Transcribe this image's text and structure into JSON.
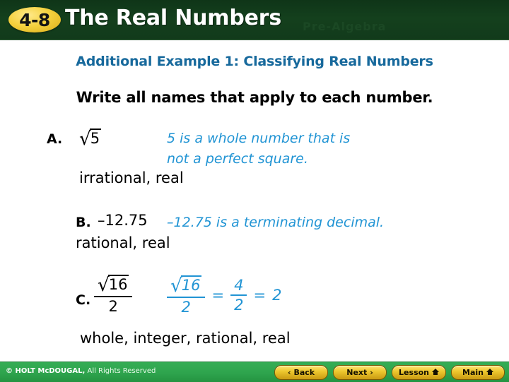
{
  "header": {
    "badge": "4-8",
    "title": "The Real Numbers",
    "watermark": "Pre-Algebra",
    "bg_color": "#123a1b",
    "badge_color": "#f5d23f"
  },
  "subtitle": "Additional Example 1: Classifying Real Numbers",
  "prompt": "Write all names that apply to each number.",
  "accent_blue": "#2194d4",
  "subtitle_color": "#17699c",
  "items": [
    {
      "letter": "A.",
      "radical_sign": "√",
      "radicand": "5",
      "note_line1": "5 is a whole number that is",
      "note_line2": "not a perfect square.",
      "answer": "irrational, real"
    },
    {
      "letter": "B.",
      "value": "–12.75",
      "note_line1": "–12.75 is a terminating decimal.",
      "answer": "rational, real"
    },
    {
      "letter": "C.",
      "radical_sign": "√",
      "radicand": "16",
      "denominator": "2",
      "eq_op1": "=",
      "eq_num": "4",
      "eq_den": "2",
      "eq_op2": "=",
      "eq_result": "2",
      "answer": "whole, integer, rational, real"
    }
  ],
  "footer": {
    "copyright_strong": "© HOLT McDOUGAL,",
    "copyright_rest": " All Rights Reserved",
    "bg_color": "#2ea44d",
    "buttons": [
      {
        "label": "Back",
        "icon": "chevron-left-icon",
        "glyph": "‹"
      },
      {
        "label": "Next",
        "icon": "chevron-right-icon",
        "glyph": "›"
      },
      {
        "label": "Lesson",
        "icon": "home-icon",
        "glyph": ""
      },
      {
        "label": "Main",
        "icon": "home-icon",
        "glyph": ""
      }
    ]
  }
}
